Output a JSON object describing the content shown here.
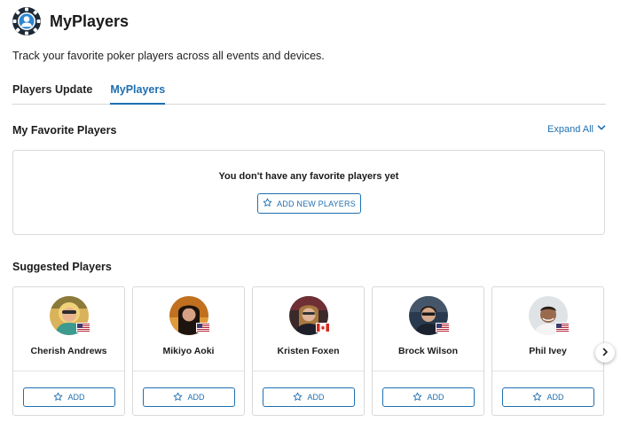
{
  "app": {
    "title": "MyPlayers",
    "subtitle": "Track your favorite poker players across all events and devices."
  },
  "tabs": [
    {
      "label": "Players Update",
      "active": false
    },
    {
      "label": "MyPlayers",
      "active": true
    }
  ],
  "favorites": {
    "title": "My Favorite Players",
    "expand_label": "Expand All",
    "empty_message": "You don't have any favorite players yet",
    "add_new_label": "ADD NEW PLAYERS"
  },
  "suggested": {
    "title": "Suggested Players",
    "add_label": "ADD",
    "players": [
      {
        "name": "Cherish Andrews",
        "flag": "usa-flag-icon"
      },
      {
        "name": "Mikiyo Aoki",
        "flag": "usa-flag-icon"
      },
      {
        "name": "Kristen Foxen",
        "flag": "canada-flag-icon"
      },
      {
        "name": "Brock Wilson",
        "flag": "usa-flag-icon"
      },
      {
        "name": "Phil Ivey",
        "flag": "usa-flag-icon"
      }
    ]
  },
  "colors": {
    "accent": "#1f6fb0",
    "border": "#d9d9d9",
    "text": "#1b1b1b"
  },
  "icons": {
    "logo": "poker-chip-person-icon",
    "expand": "chevron-down-icon",
    "star": "star-outline-icon",
    "next": "chevron-right-icon"
  }
}
